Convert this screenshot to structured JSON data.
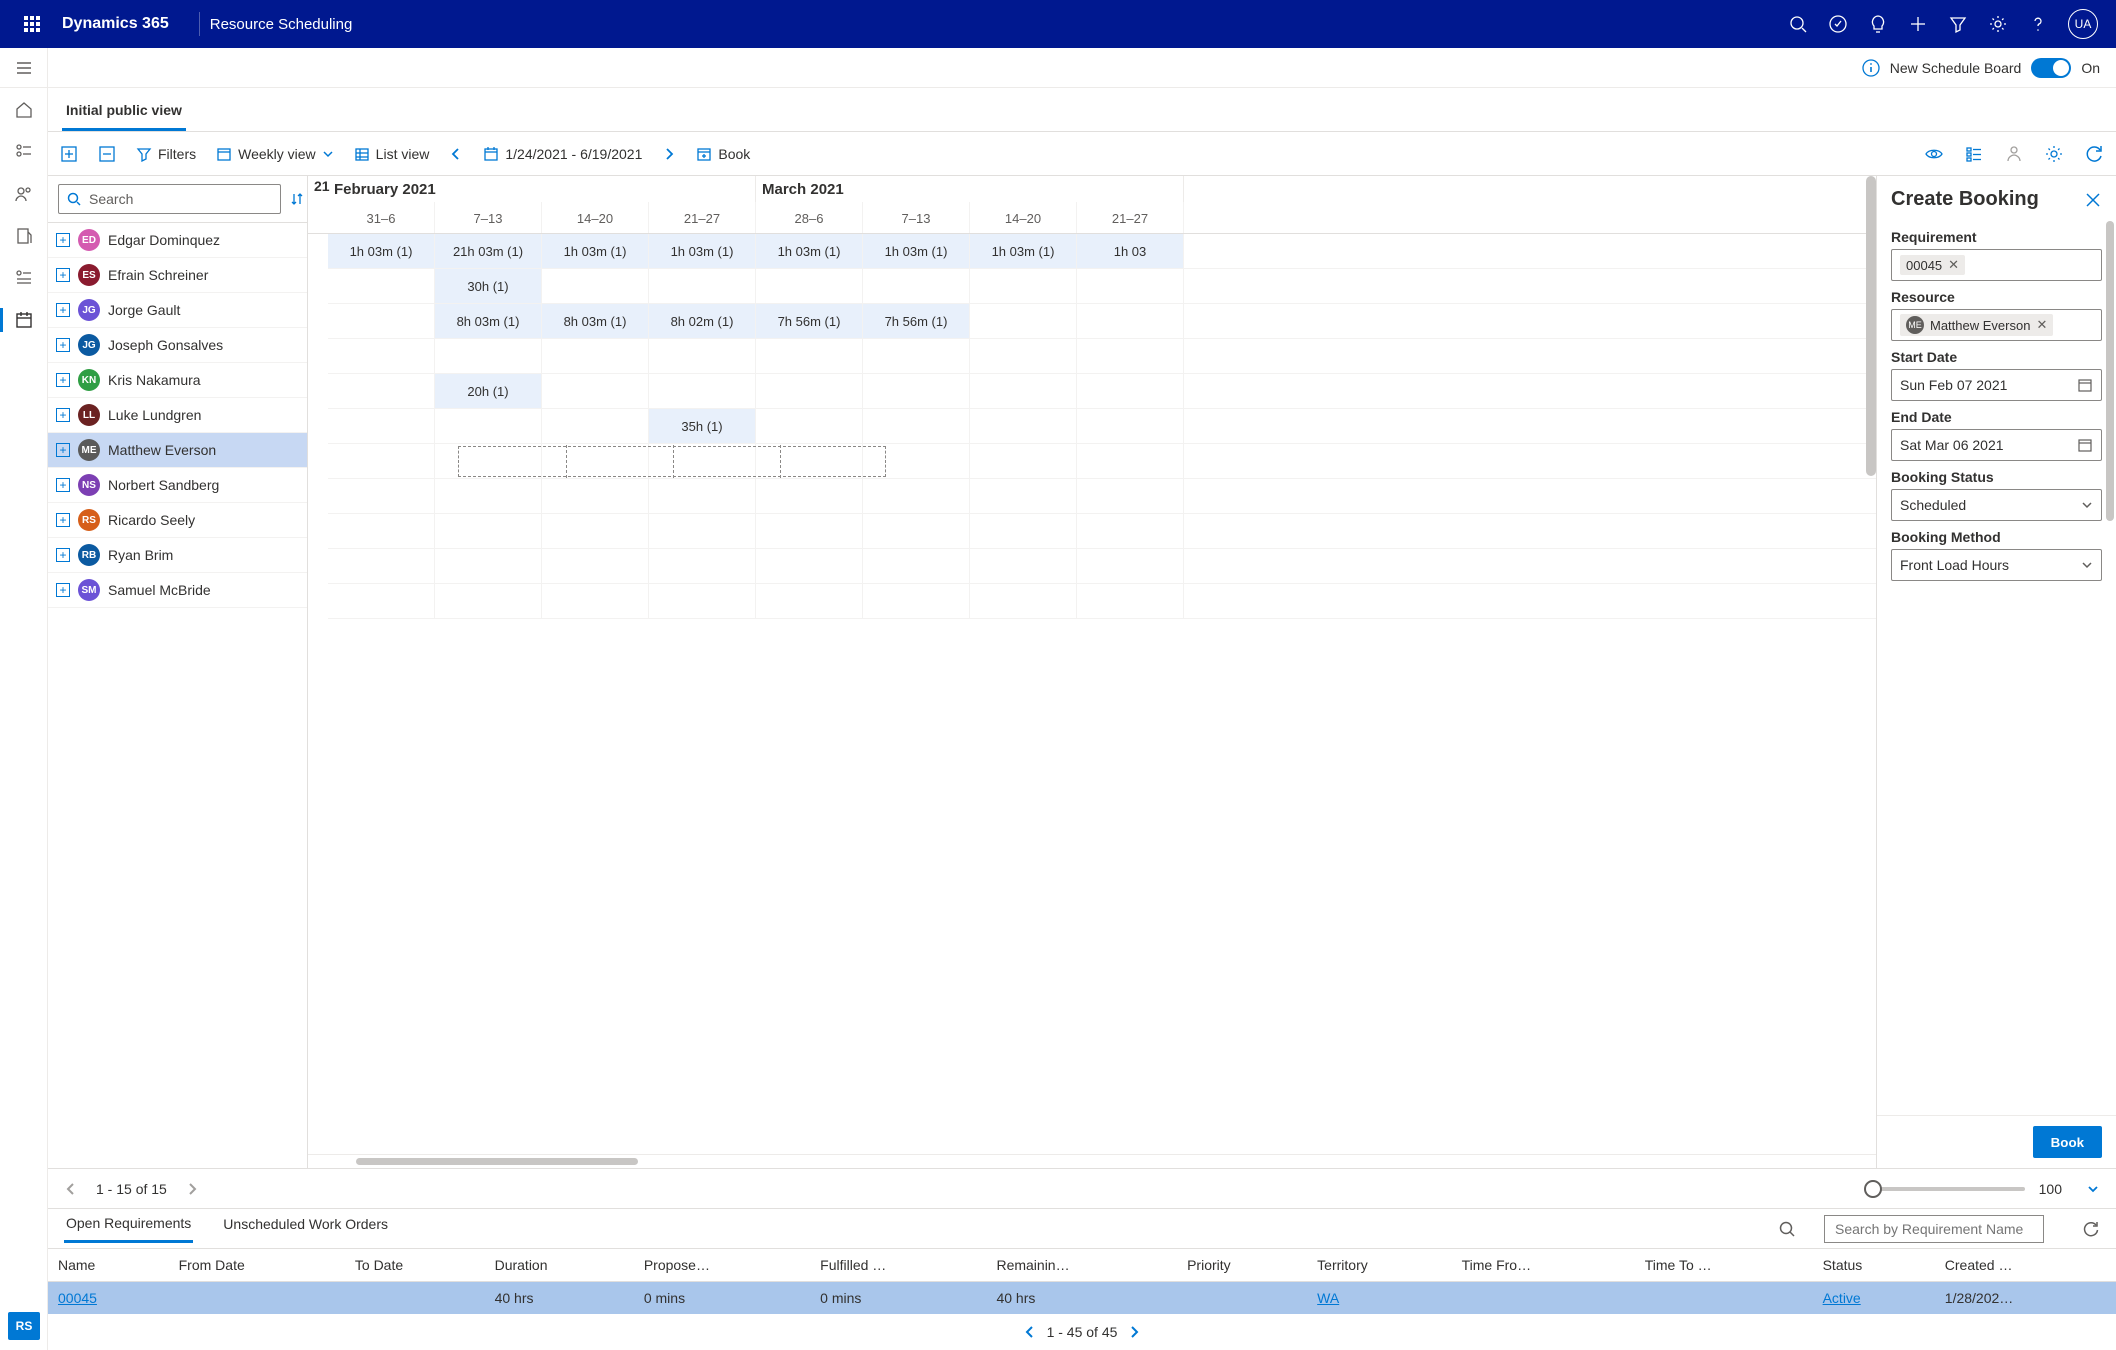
{
  "header": {
    "product": "Dynamics 365",
    "app": "Resource Scheduling",
    "avatar": "UA"
  },
  "secondbar": {
    "label": "New Schedule Board",
    "toggle_state": "On"
  },
  "view_tab": "Initial public view",
  "toolbar": {
    "filters": "Filters",
    "weekly": "Weekly view",
    "list": "List view",
    "daterange": "1/24/2021 - 6/19/2021",
    "book": "Book"
  },
  "search_placeholder": "Search",
  "resources": [
    {
      "initials": "ED",
      "name": "Edgar Dominquez",
      "color": "#d45bb0"
    },
    {
      "initials": "ES",
      "name": "Efrain Schreiner",
      "color": "#8a1b2f"
    },
    {
      "initials": "JG",
      "name": "Jorge Gault",
      "color": "#6b52d6"
    },
    {
      "initials": "JG",
      "name": "Joseph Gonsalves",
      "color": "#0b5aa1"
    },
    {
      "initials": "KN",
      "name": "Kris Nakamura",
      "color": "#2f9e44"
    },
    {
      "initials": "LL",
      "name": "Luke Lundgren",
      "color": "#6b2222"
    },
    {
      "initials": "ME",
      "name": "Matthew Everson",
      "color": "#5a5a5a",
      "selected": true
    },
    {
      "initials": "NS",
      "name": "Norbert Sandberg",
      "color": "#7c3fb3"
    },
    {
      "initials": "RS",
      "name": "Ricardo Seely",
      "color": "#d65f1a"
    },
    {
      "initials": "RB",
      "name": "Ryan Brim",
      "color": "#0b5aa1"
    },
    {
      "initials": "SM",
      "name": "Samuel McBride",
      "color": "#6b52d6"
    }
  ],
  "timeline": {
    "year_label": "21",
    "months": [
      {
        "label": "February 2021",
        "span": 4
      },
      {
        "label": "March 2021",
        "span": 4
      }
    ],
    "weeks": [
      "31–6",
      "7–13",
      "14–20",
      "21–27",
      "28–6",
      "7–13",
      "14–20",
      "21–27"
    ],
    "rows": [
      {
        "cells": [
          {
            "t": "1h 03m (1)",
            "b": true
          },
          {
            "t": "21h 03m (1)",
            "b": true
          },
          {
            "t": "1h 03m (1)",
            "b": true
          },
          {
            "t": "1h 03m (1)",
            "b": true
          },
          {
            "t": "1h 03m (1)",
            "b": true
          },
          {
            "t": "1h 03m (1)",
            "b": true
          },
          {
            "t": "1h 03m (1)",
            "b": true
          },
          {
            "t": "1h 03",
            "b": true
          }
        ]
      },
      {
        "cells": [
          {},
          {
            "t": "30h (1)",
            "b": true
          },
          {},
          {},
          {},
          {},
          {},
          {}
        ]
      },
      {
        "cells": [
          {},
          {
            "t": "8h 03m (1)",
            "b": true
          },
          {
            "t": "8h 03m (1)",
            "b": true
          },
          {
            "t": "8h 02m (1)",
            "b": true
          },
          {
            "t": "7h 56m (1)",
            "b": true
          },
          {
            "t": "7h 56m (1)",
            "b": true
          },
          {},
          {}
        ]
      },
      {
        "cells": [
          {},
          {},
          {},
          {},
          {},
          {},
          {},
          {}
        ]
      },
      {
        "cells": [
          {},
          {
            "t": "20h (1)",
            "b": true
          },
          {},
          {},
          {},
          {},
          {},
          {}
        ]
      },
      {
        "cells": [
          {},
          {},
          {},
          {
            "t": "35h (1)",
            "b": true
          },
          {},
          {},
          {},
          {}
        ]
      },
      {
        "cells": [
          {},
          {},
          {},
          {},
          {},
          {},
          {},
          {}
        ],
        "selected": true
      },
      {
        "cells": [
          {},
          {},
          {},
          {},
          {},
          {},
          {},
          {}
        ]
      },
      {
        "cells": [
          {},
          {},
          {},
          {},
          {},
          {},
          {},
          {}
        ]
      },
      {
        "cells": [
          {},
          {},
          {},
          {},
          {},
          {},
          {},
          {}
        ]
      },
      {
        "cells": [
          {},
          {},
          {},
          {},
          {},
          {},
          {},
          {}
        ]
      }
    ]
  },
  "pager": {
    "text": "1 - 15 of 15",
    "zoom": "100"
  },
  "panel": {
    "title": "Create Booking",
    "req_label": "Requirement",
    "req_value": "00045",
    "res_label": "Resource",
    "res_value": "Matthew Everson",
    "res_initials": "ME",
    "start_label": "Start Date",
    "start_value": "Sun Feb 07 2021",
    "end_label": "End Date",
    "end_value": "Sat Mar 06 2021",
    "status_label": "Booking Status",
    "status_value": "Scheduled",
    "method_label": "Booking Method",
    "method_value": "Front Load Hours",
    "book_btn": "Book"
  },
  "bottom": {
    "tab1": "Open Requirements",
    "tab2": "Unscheduled Work Orders",
    "search_placeholder": "Search by Requirement Name",
    "cols": [
      "Name",
      "From Date",
      "To Date",
      "Duration",
      "Propose…",
      "Fulfilled …",
      "Remainin…",
      "Priority",
      "Territory",
      "Time Fro…",
      "Time To …",
      "Status",
      "Created …"
    ],
    "row": {
      "name": "00045",
      "from": "",
      "to": "",
      "duration": "40 hrs",
      "proposed": "0 mins",
      "fulfilled": "0 mins",
      "remaining": "40 hrs",
      "priority": "",
      "territory": "WA",
      "timefrom": "",
      "timeto": "",
      "status": "Active",
      "created": "1/28/202…"
    },
    "pager": "1 - 45 of 45"
  }
}
